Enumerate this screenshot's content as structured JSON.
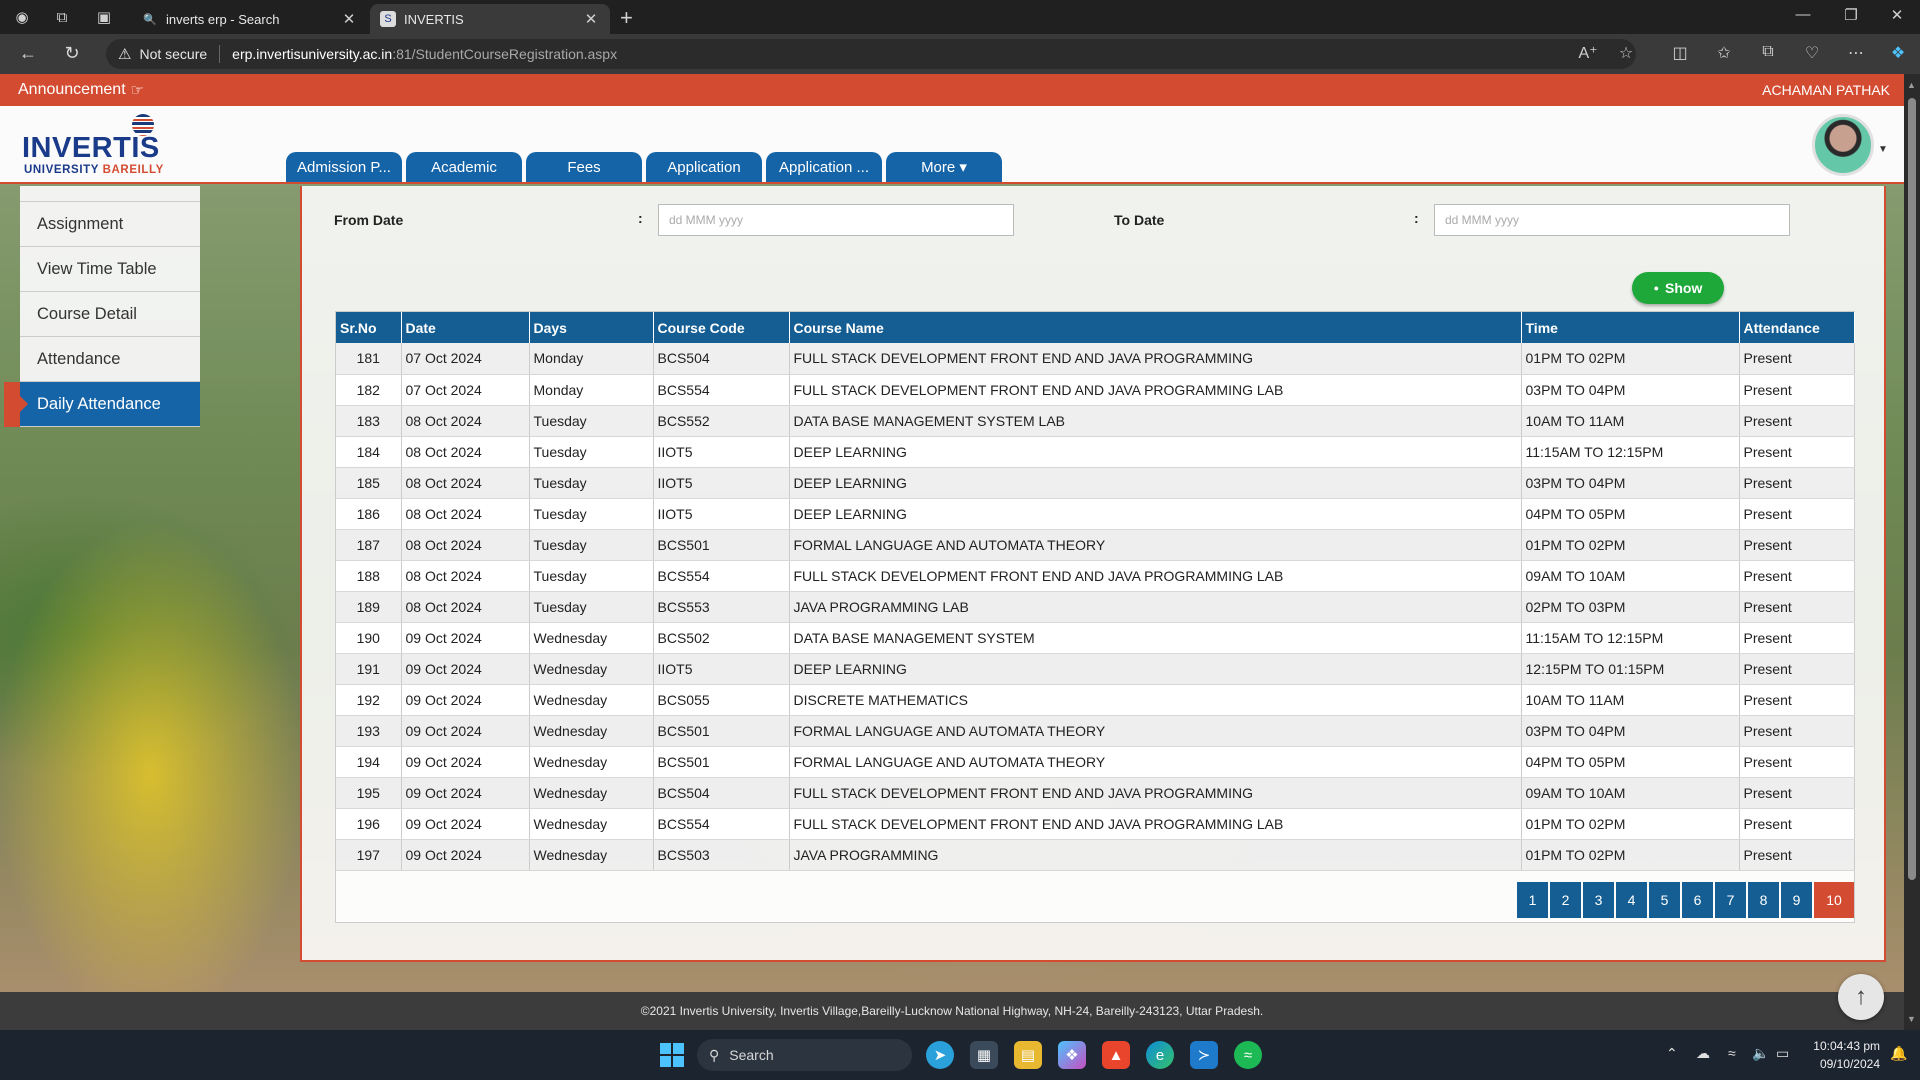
{
  "browser": {
    "tabs": [
      {
        "title": "inverts erp - Search"
      },
      {
        "title": "INVERTIS"
      }
    ],
    "security_label": "Not secure",
    "url_host": "erp.invertisuniversity.ac.in",
    "url_path": ":81/StudentCourseRegistration.aspx"
  },
  "announcement": {
    "label": "Announcement",
    "user": "ACHAMAN PATHAK"
  },
  "logo": {
    "main": "INVERTIS",
    "sub_1": "UNIVERSITY ",
    "sub_2": "BAREILLY"
  },
  "top_nav": [
    "Admission P...",
    "Academic",
    "Fees",
    "Application",
    "Application ...",
    "More ▾"
  ],
  "sidebar": {
    "items": [
      {
        "label": "Assignment",
        "active": false
      },
      {
        "label": "View Time Table",
        "active": false
      },
      {
        "label": "Course Detail",
        "active": false
      },
      {
        "label": "Attendance",
        "active": false
      },
      {
        "label": "Daily Attendance",
        "active": true
      }
    ]
  },
  "filter": {
    "from_label": "From Date",
    "to_label": "To Date",
    "colon": ":",
    "from_placeholder": "dd MMM yyyy",
    "to_placeholder": "dd MMM yyyy",
    "show_label": "Show"
  },
  "table": {
    "headers": [
      "Sr.No",
      "Date",
      "Days",
      "Course Code",
      "Course Name",
      "Time",
      "Attendance"
    ],
    "rows": [
      [
        "181",
        "07 Oct 2024",
        "Monday",
        "BCS504",
        "FULL STACK DEVELOPMENT FRONT END AND JAVA PROGRAMMING",
        "01PM TO 02PM",
        "Present"
      ],
      [
        "182",
        "07 Oct 2024",
        "Monday",
        "BCS554",
        "FULL STACK DEVELOPMENT FRONT END AND JAVA PROGRAMMING LAB",
        "03PM TO 04PM",
        "Present"
      ],
      [
        "183",
        "08 Oct 2024",
        "Tuesday",
        "BCS552",
        "DATA BASE MANAGEMENT SYSTEM LAB",
        "10AM TO 11AM",
        "Present"
      ],
      [
        "184",
        "08 Oct 2024",
        "Tuesday",
        "IIOT5",
        "DEEP LEARNING",
        "11:15AM TO 12:15PM",
        "Present"
      ],
      [
        "185",
        "08 Oct 2024",
        "Tuesday",
        "IIOT5",
        "DEEP LEARNING",
        "03PM TO 04PM",
        "Present"
      ],
      [
        "186",
        "08 Oct 2024",
        "Tuesday",
        "IIOT5",
        "DEEP LEARNING",
        "04PM TO 05PM",
        "Present"
      ],
      [
        "187",
        "08 Oct 2024",
        "Tuesday",
        "BCS501",
        "FORMAL LANGUAGE AND AUTOMATA THEORY",
        "01PM TO 02PM",
        "Present"
      ],
      [
        "188",
        "08 Oct 2024",
        "Tuesday",
        "BCS554",
        "FULL STACK DEVELOPMENT FRONT END AND JAVA PROGRAMMING LAB",
        "09AM TO 10AM",
        "Present"
      ],
      [
        "189",
        "08 Oct 2024",
        "Tuesday",
        "BCS553",
        "JAVA PROGRAMMING LAB",
        "02PM TO 03PM",
        "Present"
      ],
      [
        "190",
        "09 Oct 2024",
        "Wednesday",
        "BCS502",
        "DATA BASE MANAGEMENT SYSTEM",
        "11:15AM TO 12:15PM",
        "Present"
      ],
      [
        "191",
        "09 Oct 2024",
        "Wednesday",
        "IIOT5",
        "DEEP LEARNING",
        "12:15PM TO 01:15PM",
        "Present"
      ],
      [
        "192",
        "09 Oct 2024",
        "Wednesday",
        "BCS055",
        "DISCRETE MATHEMATICS",
        "10AM TO 11AM",
        "Present"
      ],
      [
        "193",
        "09 Oct 2024",
        "Wednesday",
        "BCS501",
        "FORMAL LANGUAGE AND AUTOMATA THEORY",
        "03PM TO 04PM",
        "Present"
      ],
      [
        "194",
        "09 Oct 2024",
        "Wednesday",
        "BCS501",
        "FORMAL LANGUAGE AND AUTOMATA THEORY",
        "04PM TO 05PM",
        "Present"
      ],
      [
        "195",
        "09 Oct 2024",
        "Wednesday",
        "BCS504",
        "FULL STACK DEVELOPMENT FRONT END AND JAVA PROGRAMMING",
        "09AM TO 10AM",
        "Present"
      ],
      [
        "196",
        "09 Oct 2024",
        "Wednesday",
        "BCS554",
        "FULL STACK DEVELOPMENT FRONT END AND JAVA PROGRAMMING LAB",
        "01PM TO 02PM",
        "Present"
      ],
      [
        "197",
        "09 Oct 2024",
        "Wednesday",
        "BCS503",
        "JAVA PROGRAMMING",
        "01PM TO 02PM",
        "Present"
      ]
    ]
  },
  "pagination": {
    "pages": [
      "1",
      "2",
      "3",
      "4",
      "5",
      "6",
      "7",
      "8",
      "9",
      "10"
    ],
    "current": "10"
  },
  "footer": {
    "text": "©2021 Invertis University, Invertis Village,Bareilly-Lucknow National Highway, NH-24, Bareilly-243123, Uttar Pradesh."
  },
  "taskbar": {
    "search_label": "Search",
    "time": "10:04:43 pm",
    "date": "09/10/2024"
  },
  "colors": {
    "accent_red": "#d34c32",
    "nav_blue": "#1564a8",
    "table_header": "#145e93",
    "show_green": "#1fa83a"
  }
}
